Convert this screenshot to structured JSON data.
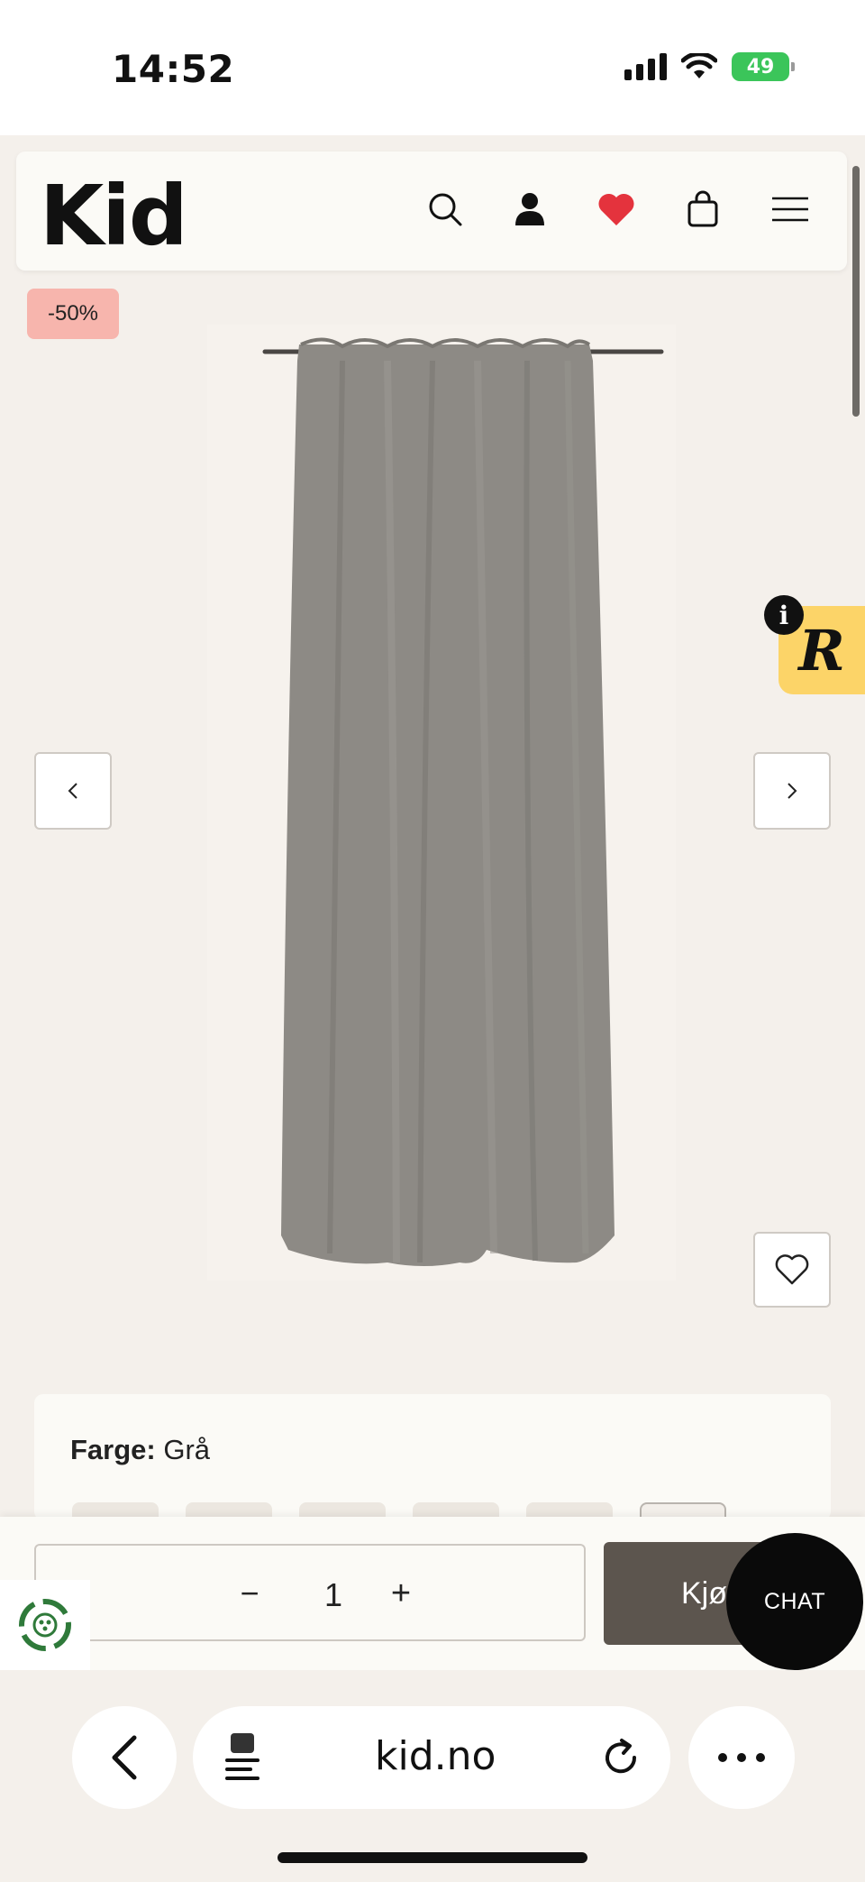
{
  "status_bar": {
    "time": "14:52",
    "battery": "49"
  },
  "header": {
    "logo": "Kid",
    "icons": [
      "search-icon",
      "user-icon",
      "heart-icon",
      "bag-icon",
      "menu-icon"
    ],
    "favorite_color": "#e4333d"
  },
  "product": {
    "discount_badge": "-50%",
    "image": "grey curtain panel",
    "prev_icon": "chevron-left-icon",
    "next_icon": "chevron-right-icon",
    "wishlist_icon": "heart-outline-icon"
  },
  "widget": {
    "info": "i",
    "letter": "R"
  },
  "color_selector": {
    "label": "Farge:",
    "value": "Grå",
    "swatch_count": 6,
    "selected_index": 5
  },
  "buy_bar": {
    "quantity": "1",
    "minus": "−",
    "plus": "+",
    "buy_label": "Kjøp",
    "chat_label": "CHAT"
  },
  "browser": {
    "url": "kid.no"
  },
  "colors": {
    "page_bg": "#f4f0eb",
    "badge_bg": "#f7b5ad",
    "buy_button": "#5c554e",
    "widget_bg": "#fcd468",
    "battery": "#3bc55a"
  }
}
